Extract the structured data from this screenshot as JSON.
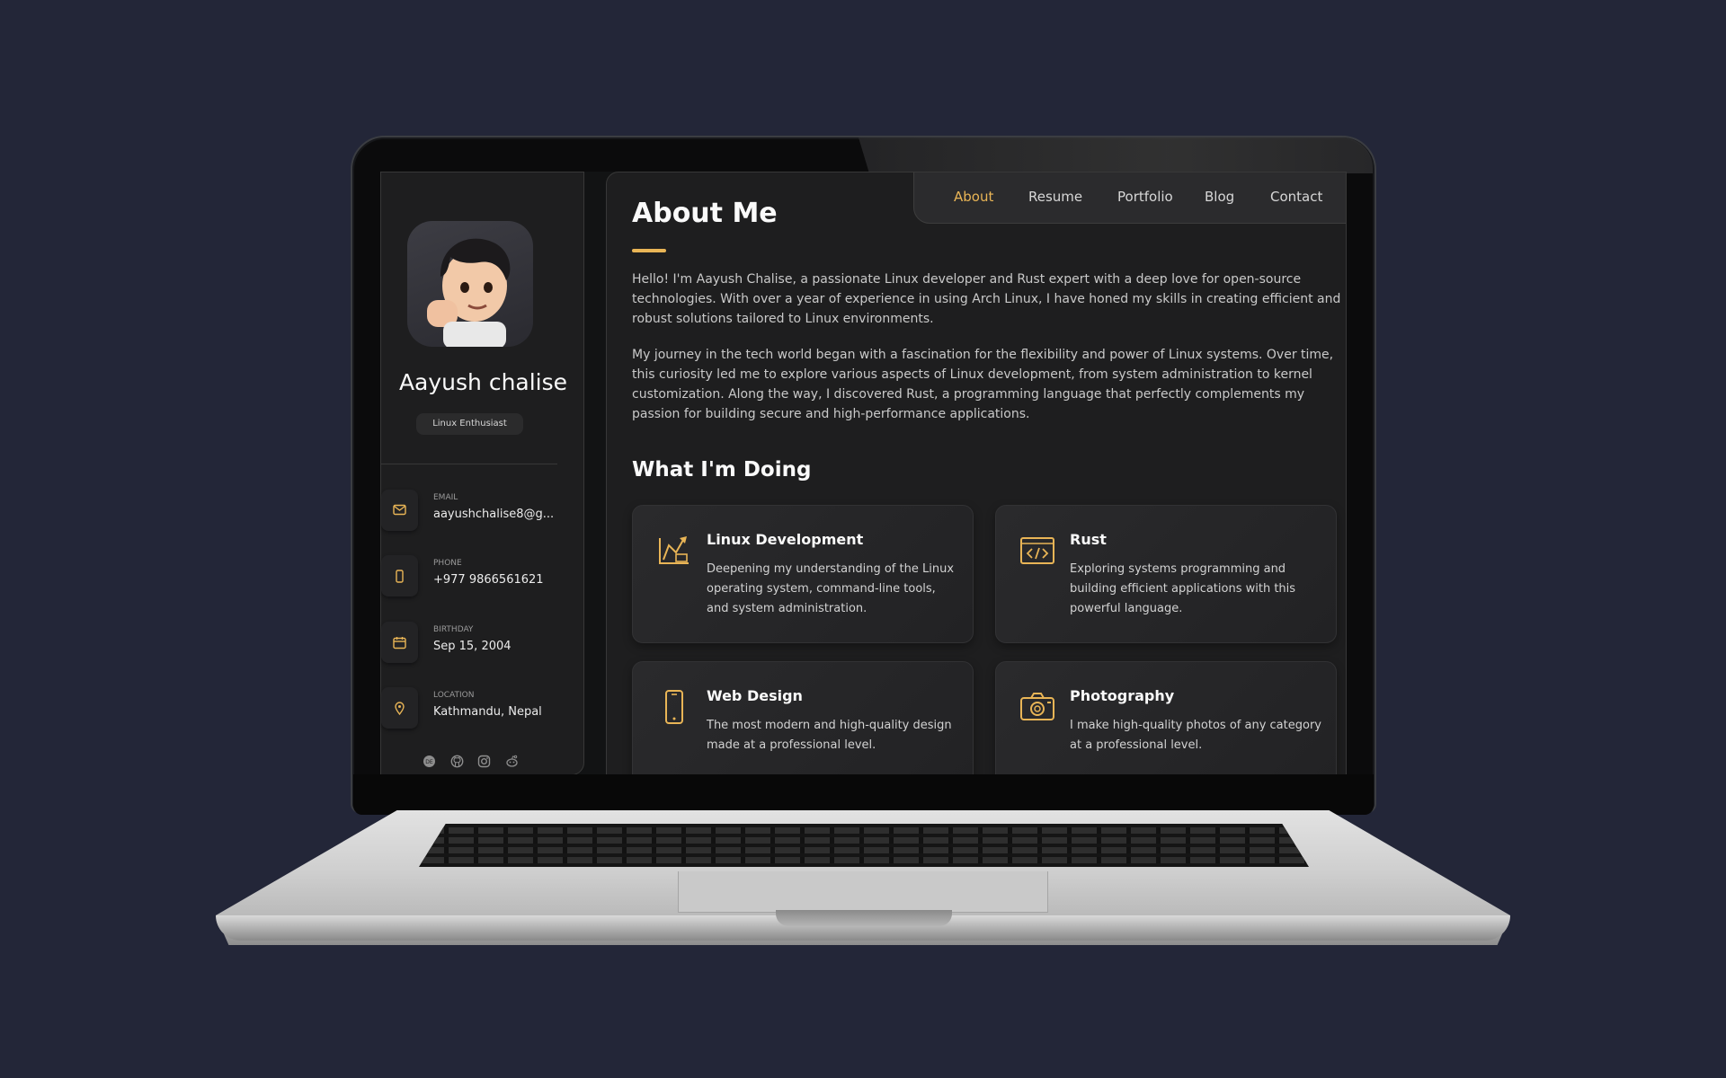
{
  "profile": {
    "name": "Aayush chalise",
    "title": "Linux Enthusiast"
  },
  "contacts": [
    {
      "icon": "mail-icon",
      "label": "EMAIL",
      "value": "aayushchalise8@g..."
    },
    {
      "icon": "phone-icon",
      "label": "PHONE",
      "value": "+977 9866561621"
    },
    {
      "icon": "calendar-icon",
      "label": "BIRTHDAY",
      "value": "Sep 15, 2004"
    },
    {
      "icon": "location-icon",
      "label": "LOCATION",
      "value": "Kathmandu, Nepal"
    }
  ],
  "socials": [
    "dev-icon",
    "github-icon",
    "instagram-icon",
    "reddit-icon"
  ],
  "nav": {
    "items": [
      "About",
      "Resume",
      "Portfolio",
      "Blog",
      "Contact"
    ],
    "active": "About"
  },
  "about": {
    "heading": "About Me",
    "paragraphs": [
      "Hello! I'm Aayush Chalise, a passionate Linux developer and Rust expert with a deep love for open-source technologies. With over a year of experience in using Arch Linux, I have honed my skills in creating efficient and robust solutions tailored to Linux environments.",
      "My journey in the tech world began with a fascination for the flexibility and power of Linux systems. Over time, this curiosity led me to explore various aspects of Linux development, from system administration to kernel customization. Along the way, I discovered Rust, a programming language that perfectly complements my passion for building secure and high-performance applications."
    ]
  },
  "services": {
    "heading": "What I'm Doing",
    "items": [
      {
        "icon": "design-icon",
        "title": "Linux Development",
        "text": "Deepening my understanding of the Linux operating system, command-line tools, and system administration."
      },
      {
        "icon": "code-icon",
        "title": "Rust",
        "text": "Exploring systems programming and building efficient applications with this powerful language."
      },
      {
        "icon": "mobile-icon",
        "title": "Web Design",
        "text": "The most modern and high-quality design made at a professional level."
      },
      {
        "icon": "camera-icon",
        "title": "Photography",
        "text": "I make high-quality photos of any category at a professional level."
      }
    ]
  },
  "colors": {
    "accent": "#e9b556",
    "background": "#232638",
    "panel": "#1e1e1f"
  }
}
